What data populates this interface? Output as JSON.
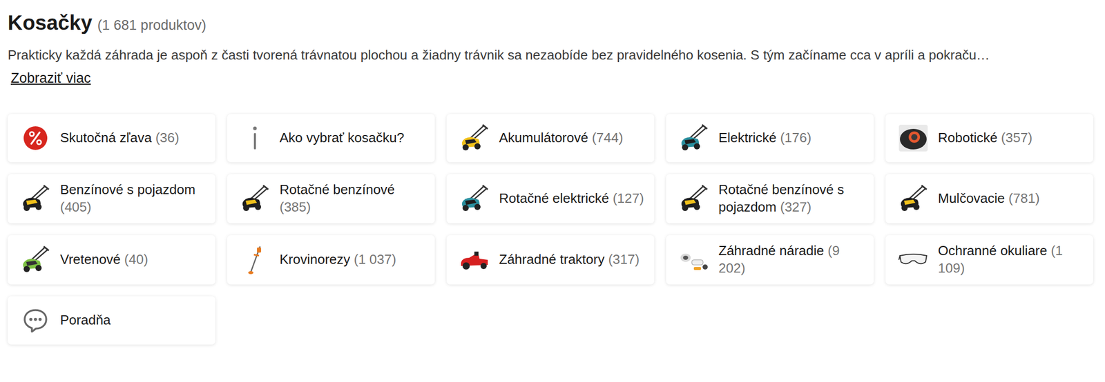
{
  "header": {
    "title": "Kosačky",
    "count": "(1 681 produktov)"
  },
  "description": {
    "text": "Prakticky každá záhrada je aspoň z časti tvorená trávnatou plochou a žiadny trávnik sa nezaobíde bez pravidelného kosenia. S tým začíname cca v apríli a pokraču…",
    "link": "Zobraziť viac"
  },
  "categories": [
    {
      "label": "Skutočná zľava",
      "count": "(36)"
    },
    {
      "label": "Ako vybrať kosačku?"
    },
    {
      "label": "Akumulátorové",
      "count": "(744)"
    },
    {
      "label": "Elektrické",
      "count": "(176)"
    },
    {
      "label": "Robotické",
      "count": "(357)"
    },
    {
      "label": "Benzínové s pojazdom",
      "count": "(405)"
    },
    {
      "label": "Rotačné benzínové",
      "count": "(385)"
    },
    {
      "label": "Rotačné elektrické",
      "count": "(127)"
    },
    {
      "label": "Rotačné benzínové s pojazdom",
      "count": "(327)"
    },
    {
      "label": "Mulčovacie",
      "count": "(781)"
    },
    {
      "label": "Vretenové",
      "count": "(40)"
    },
    {
      "label": "Krovinorezy",
      "count": "(1 037)"
    },
    {
      "label": "Záhradné traktory",
      "count": "(317)"
    },
    {
      "label": "Záhradné náradie",
      "count": "(9 202)"
    },
    {
      "label": "Ochranné okuliare",
      "count": "(1 109)"
    },
    {
      "label": "Poradňa"
    }
  ]
}
